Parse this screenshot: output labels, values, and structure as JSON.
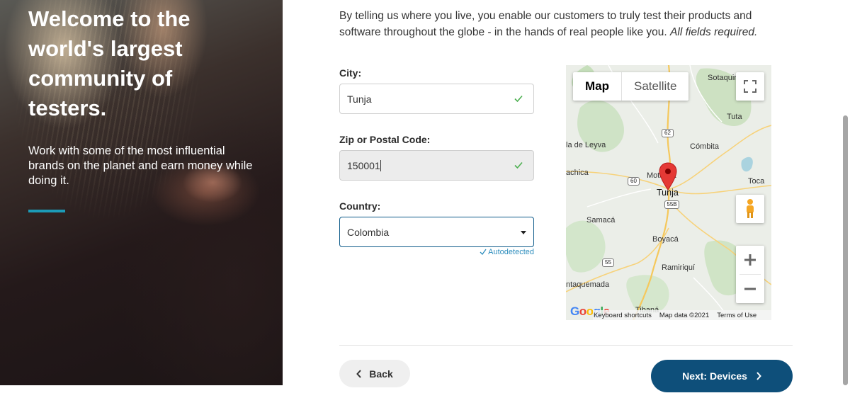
{
  "hero": {
    "title": "Welcome to the world's largest community of testers.",
    "subtitle": "Work with some of the most influential brands on the planet and earn money while doing it.",
    "accent_color": "#1c9bb7"
  },
  "intro": {
    "text": "By telling us where you live, you enable our customers to truly test their products and software throughout the globe - in the hands of real people like you.",
    "required_note": "All fields required."
  },
  "form": {
    "city": {
      "label": "City:",
      "value": "Tunja",
      "valid": true
    },
    "zip": {
      "label": "Zip or Postal Code:",
      "value": "150001",
      "valid": true
    },
    "country": {
      "label": "Country:",
      "value": "Colombia",
      "note": "Autodetected"
    }
  },
  "map": {
    "tabs": [
      "Map",
      "Satellite"
    ],
    "selected_tab": "Map",
    "places": [
      "Sotaquirá",
      "Tuta",
      "Cómbita",
      "la de Leyva",
      "achica",
      "Motavita",
      "Tunja",
      "Toca",
      "Samacá",
      "Boyacá",
      "Ramiriquí",
      "ntaquemada",
      "Tibaná"
    ],
    "route_shields": [
      "62",
      "60",
      "55B",
      "55"
    ],
    "pin_location": "Tunja",
    "google_label": "Google",
    "footer": {
      "shortcuts": "Keyboard shortcuts",
      "data": "Map data ©2021",
      "terms": "Terms of Use"
    },
    "icons": [
      "fullscreen-icon",
      "pegman-icon",
      "zoom-in-icon",
      "zoom-out-icon",
      "map-pin-icon"
    ]
  },
  "actions": {
    "back_label": "Back",
    "next_label": "Next: Devices",
    "next_color": "#0e4f7a"
  }
}
